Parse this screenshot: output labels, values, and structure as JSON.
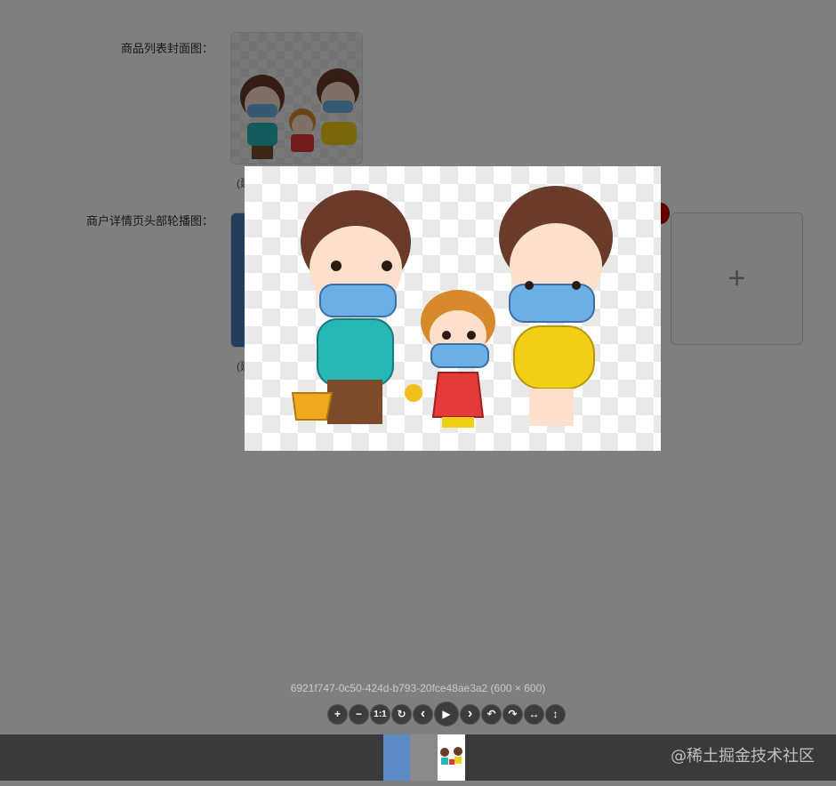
{
  "form": {
    "cover_label": "商品列表封面图：",
    "carousel_label": "商户详情页头部轮播图："
  },
  "upload": {
    "cover_note": "(建",
    "carousel_note": "(建",
    "add_symbol": "+"
  },
  "viewer": {
    "caption": "6921f747-0c50-424d-b793-20fce48ae3a2 (600 × 600)",
    "toolbar": [
      {
        "name": "zoom-in-button",
        "glyph": "+"
      },
      {
        "name": "zoom-out-button",
        "glyph": "−"
      },
      {
        "name": "one-to-one-button",
        "glyph": "1:1"
      },
      {
        "name": "reset-button",
        "glyph": "↻"
      },
      {
        "name": "prev-button",
        "glyph": "‹"
      },
      {
        "name": "play-button",
        "glyph": "▶"
      },
      {
        "name": "next-button",
        "glyph": "›"
      },
      {
        "name": "rotate-left-button",
        "glyph": "↶"
      },
      {
        "name": "rotate-right-button",
        "glyph": "↷"
      },
      {
        "name": "flip-horizontal-button",
        "glyph": "↔"
      },
      {
        "name": "flip-vertical-button",
        "glyph": "↕"
      }
    ]
  },
  "watermark": "@稀土掘金技术社区"
}
